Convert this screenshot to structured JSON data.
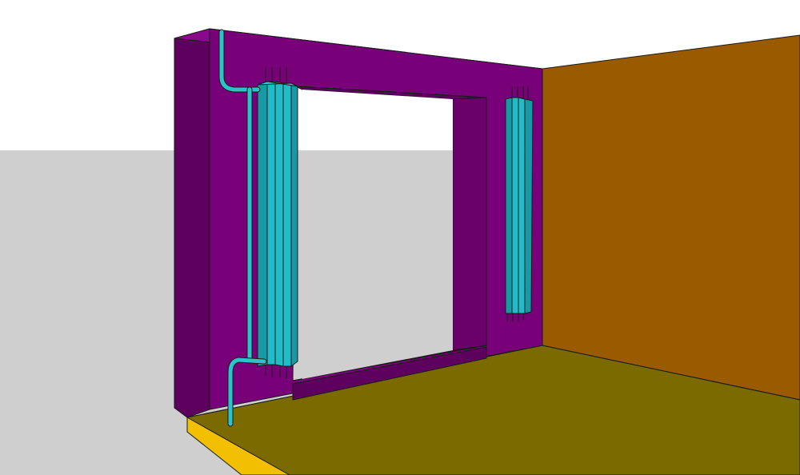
{
  "scene": {
    "colors": {
      "sky": "#ffffff",
      "ground": "#cfcfcf",
      "wall_front": "#780078",
      "wall_side": "#5e005e",
      "wall_reveal": "#6a006a",
      "wall_top": "#8a088a",
      "side_wall": "#9a5a00",
      "floor": "#7a6a00",
      "floor_edge": "#f2c000",
      "radiator": "#22bcc8",
      "radiator_dark": "#179aa6",
      "pipe": "#2cc4cc",
      "edge": "#1a1a1a"
    },
    "objects": [
      "purple-wall-with-window-opening",
      "orange-side-wall",
      "olive-floor-slab",
      "left-radiator",
      "right-radiator",
      "heating-pipe"
    ]
  }
}
